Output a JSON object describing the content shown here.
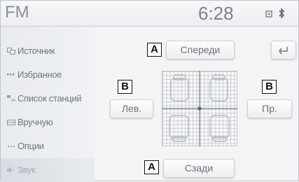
{
  "header": {
    "band": "FM",
    "time": "6:28",
    "signal_icon": "signal-strength-icon",
    "bluetooth_icon": "bluetooth-icon"
  },
  "sidebar": {
    "items": [
      {
        "label": "Источник",
        "icon": "source-icon",
        "active": false
      },
      {
        "label": "Избранное",
        "icon": "favorites-icon",
        "active": false
      },
      {
        "label": "Список станций",
        "icon": "station-list-icon",
        "active": false
      },
      {
        "label": "Вручную",
        "icon": "manual-icon",
        "active": false
      },
      {
        "label": "Опции",
        "icon": "options-icon",
        "active": false
      },
      {
        "label": "Звук",
        "icon": "sound-icon",
        "active": true
      }
    ]
  },
  "balance": {
    "front_label": "Спереди",
    "rear_label": "Сзади",
    "left_label": "Лев.",
    "right_label": "Пр.",
    "back_icon": "back-arrow-icon",
    "grid_icon": "balance-fader-grid"
  },
  "callouts": {
    "front": "A",
    "rear": "A",
    "left": "B",
    "right": "B"
  }
}
